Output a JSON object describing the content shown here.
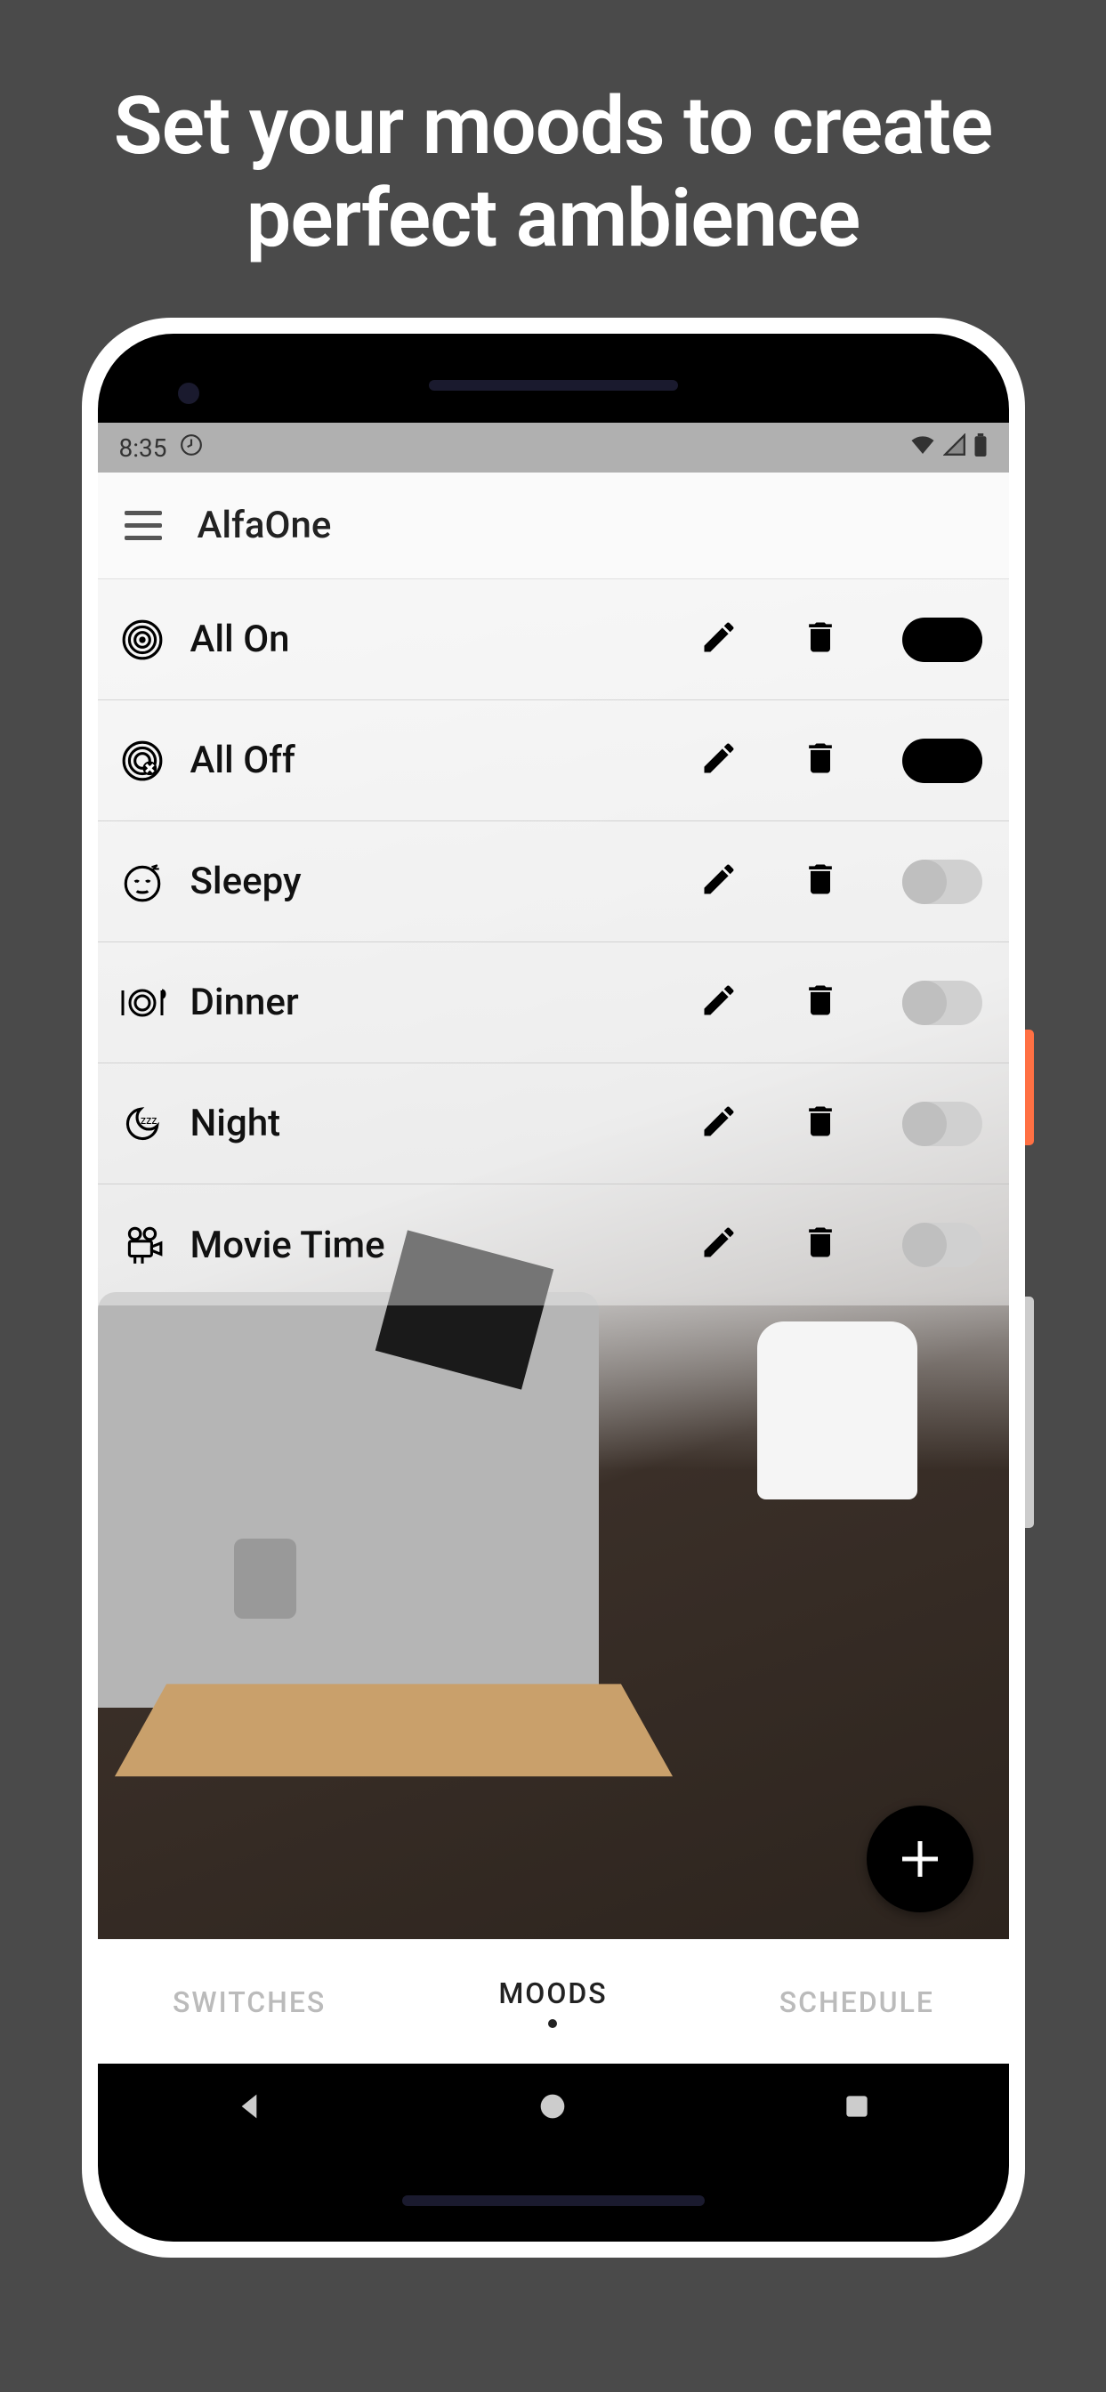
{
  "headline": "Set your moods to create perfect ambience",
  "statusBar": {
    "time": "8:35"
  },
  "appBar": {
    "title": "AlfaOne"
  },
  "moods": [
    {
      "icon": "fingerprint",
      "label": "All On",
      "on": true
    },
    {
      "icon": "fingerprint-off",
      "label": "All Off",
      "on": true
    },
    {
      "icon": "sleepy-face",
      "label": "Sleepy",
      "on": false
    },
    {
      "icon": "dinner-plate",
      "label": "Dinner",
      "on": false
    },
    {
      "icon": "moon-zzz",
      "label": "Night",
      "on": false
    },
    {
      "icon": "movie-camera",
      "label": "Movie Time",
      "on": false
    }
  ],
  "tabs": {
    "left": "SWITCHES",
    "center": "MOODS",
    "right": "SCHEDULE",
    "active": "center"
  }
}
